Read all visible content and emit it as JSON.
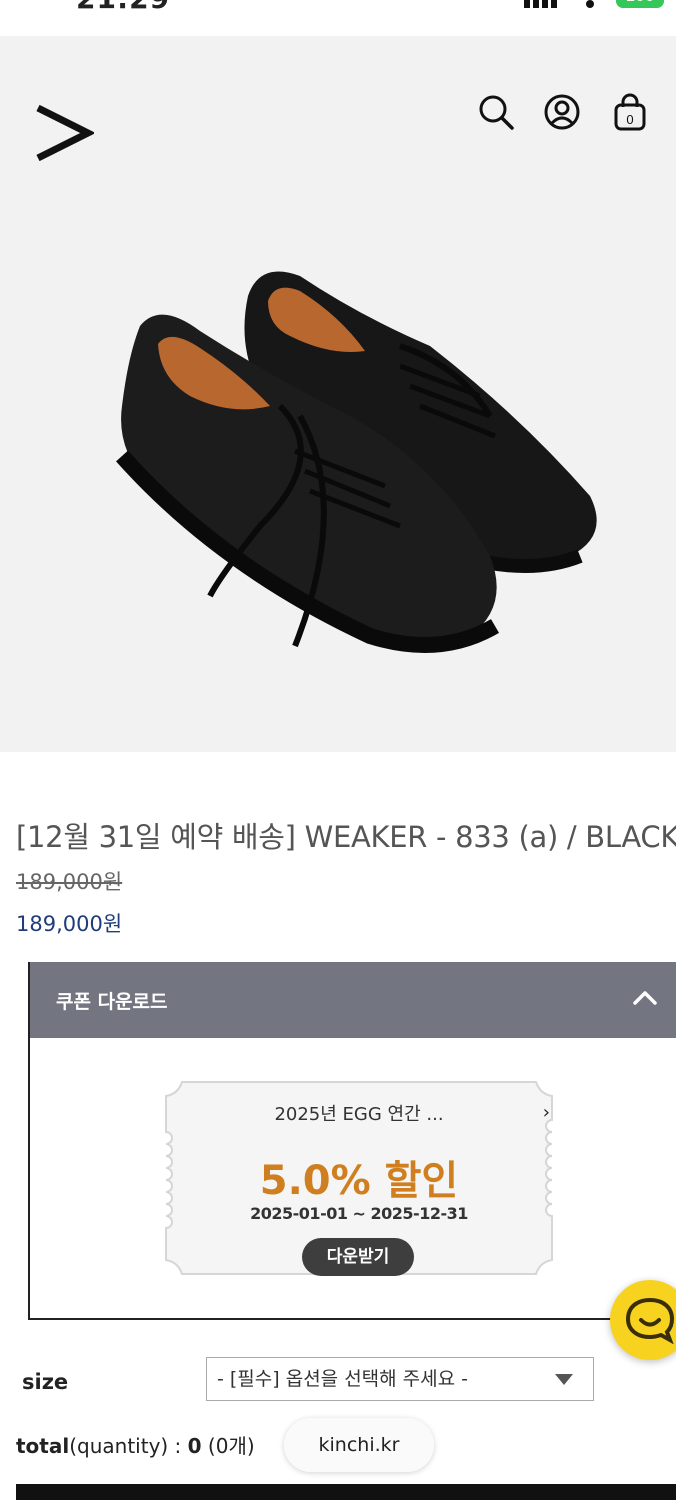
{
  "status_bar": {
    "time": "21:29",
    "battery": "100"
  },
  "header": {
    "logo": "brand-logo-arrow",
    "icons": [
      "search-icon",
      "account-icon",
      "shopping-bag-icon"
    ]
  },
  "product": {
    "title": "[12월 31일 예약 배송] WEAKER - 833 (a) / BLACK",
    "original_price": "189,000원",
    "sale_price": "189,000원"
  },
  "coupon": {
    "header_label": "쿠폰 다운로드",
    "name": "2025년 EGG 연간 ...",
    "discount": "5.0% 할인",
    "dates": "2025-01-01 ~ 2025-12-31",
    "download_button": "다운받기",
    "colors": {
      "header_bg": "#737680",
      "discount": "#cf7f1f",
      "button_bg": "#3e3e3e"
    }
  },
  "options": {
    "size_label": "size",
    "size_select_value": "- [필수] 옵션을 선택해 주세요 -"
  },
  "total": {
    "label": "total",
    "sub_label": "(quantity)",
    "colon": " : ",
    "count": "0",
    "count_unit": " (0개)"
  },
  "browser": {
    "url": "kinchi.kr"
  },
  "colors": {
    "sale_price": "#1f3d7a",
    "chat_button": "#f7d21e"
  }
}
